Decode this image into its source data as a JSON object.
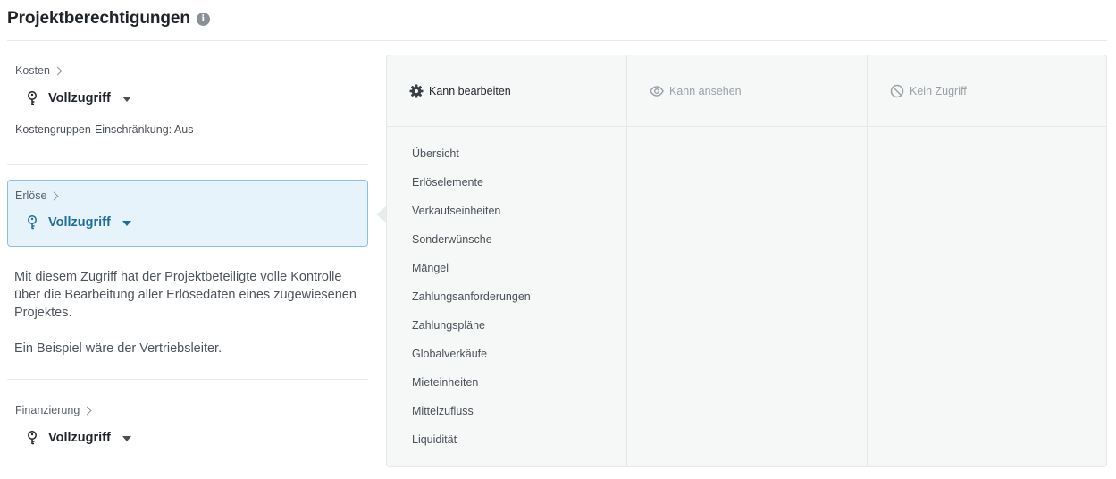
{
  "page": {
    "title": "Projektberechtigungen",
    "info_glyph": "i"
  },
  "sections": {
    "kosten": {
      "title": "Kosten",
      "access": "Vollzugriff",
      "note": "Kostengruppen-Einschränkung: Aus"
    },
    "erloese": {
      "title": "Erlöse",
      "access": "Vollzugriff"
    },
    "finanzierung": {
      "title": "Finanzierung",
      "access": "Vollzugriff"
    }
  },
  "description": {
    "line1": "Mit diesem Zugriff hat der Projektbeteiligte volle Kontrolle über die Bearbeitung aller Erlösedaten eines zugewiesenen Projektes.",
    "line2": "Ein Beispiel wäre der Vertriebsleiter."
  },
  "panel": {
    "columns": {
      "edit": {
        "label": "Kann bearbeiten",
        "icon": "gear-icon"
      },
      "view": {
        "label": "Kann ansehen",
        "icon": "eye-icon"
      },
      "none": {
        "label": "Kein Zugriff",
        "icon": "no-access-icon"
      }
    },
    "edit_items": [
      "Übersicht",
      "Erlöselemente",
      "Verkaufseinheiten",
      "Sonderwünsche",
      "Mängel",
      "Zahlungsanforderungen",
      "Zahlungspläne",
      "Globalverkäufe",
      "Mieteinheiten",
      "Mittelzufluss",
      "Liquidität"
    ]
  },
  "colors": {
    "accent": "#1d6e9c",
    "active_bg": "#e7f3fb",
    "active_border": "#8dbfde",
    "panel_bg": "#f6f8f8"
  }
}
